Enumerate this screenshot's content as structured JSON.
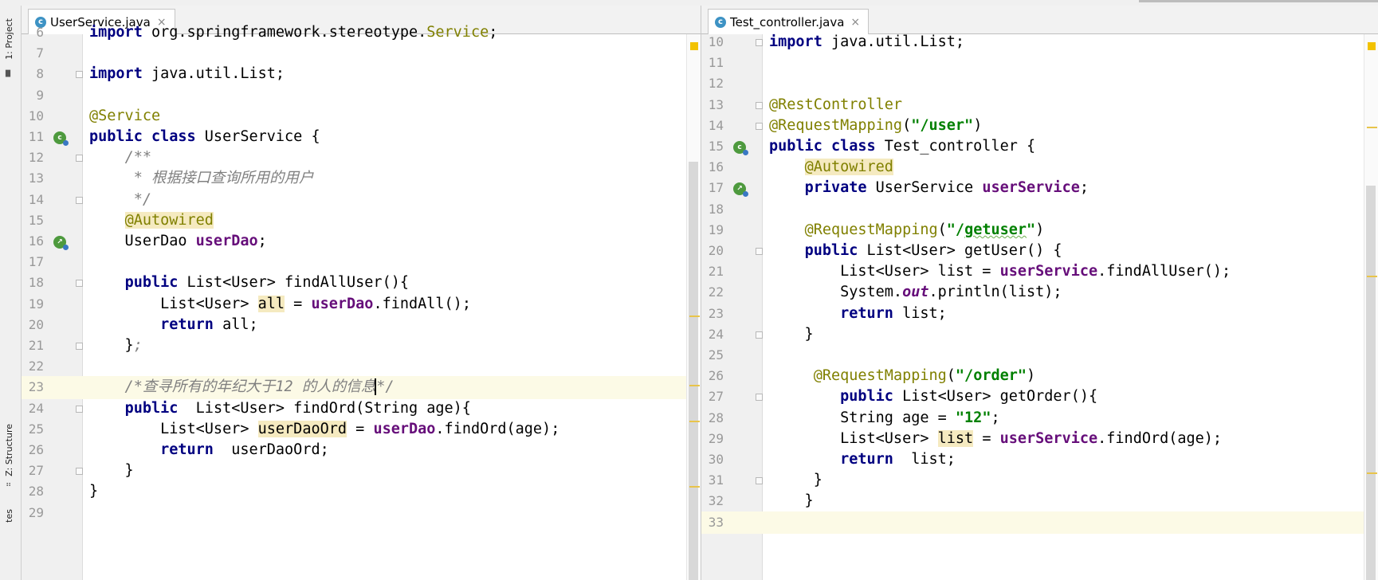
{
  "sidebar": {
    "project_tab": "1: Project",
    "structure_tab": "Z: Structure",
    "bottom_tab": "tes"
  },
  "left_editor": {
    "tab": {
      "label": "UserService.java",
      "icon_letter": "c"
    },
    "lines": [
      {
        "num": "6",
        "html": "<span class=\"kw\">import</span> org.springframework.stereotype.<span class=\"ann\">Service</span>;",
        "fold": false,
        "gutter_icon": "none",
        "current": false
      },
      {
        "num": "7",
        "html": "",
        "fold": false,
        "gutter_icon": "none",
        "current": false
      },
      {
        "num": "8",
        "html": "<span class=\"kw\">import</span> java.util.List;",
        "fold": true,
        "gutter_icon": "none",
        "current": false
      },
      {
        "num": "9",
        "html": "",
        "fold": false,
        "gutter_icon": "none",
        "current": false
      },
      {
        "num": "10",
        "html": "<span class=\"ann\">@Service</span>",
        "fold": false,
        "gutter_icon": "none",
        "current": false
      },
      {
        "num": "11",
        "html": "<span class=\"kw\">public class</span> UserService {",
        "fold": false,
        "gutter_icon": "bean",
        "current": false
      },
      {
        "num": "12",
        "html": "    <span class=\"cmt\">/**</span>",
        "fold": true,
        "gutter_icon": "none",
        "current": false
      },
      {
        "num": "13",
        "html": "<span class=\"cmt\">     * 根据接口查询所用的用户</span>",
        "fold": false,
        "gutter_icon": "none",
        "current": false
      },
      {
        "num": "14",
        "html": "<span class=\"cmt\">     */</span>",
        "fold": true,
        "gutter_icon": "none",
        "current": false
      },
      {
        "num": "15",
        "html": "    <span class=\"ann hl\">@Autowired</span>",
        "fold": false,
        "gutter_icon": "none",
        "current": false
      },
      {
        "num": "16",
        "html": "    UserDao <span class=\"fld\">userDao</span>;",
        "fold": false,
        "gutter_icon": "autowire",
        "current": false
      },
      {
        "num": "17",
        "html": "",
        "fold": false,
        "gutter_icon": "none",
        "current": false
      },
      {
        "num": "18",
        "html": "    <span class=\"kw\">public</span> List&lt;User&gt; findAllUser(){",
        "fold": true,
        "gutter_icon": "none",
        "current": false
      },
      {
        "num": "19",
        "html": "        List&lt;User&gt; <span class=\"hl\">all</span> = <span class=\"fld\">userDao</span>.findAll();",
        "fold": false,
        "gutter_icon": "none",
        "current": false
      },
      {
        "num": "20",
        "html": "        <span class=\"kw\">return</span> all;",
        "fold": false,
        "gutter_icon": "none",
        "current": false
      },
      {
        "num": "21",
        "html": "    }<span class=\"cmt\">;</span>",
        "fold": true,
        "gutter_icon": "none",
        "current": false
      },
      {
        "num": "22",
        "html": "",
        "fold": false,
        "gutter_icon": "none",
        "current": false
      },
      {
        "num": "23",
        "html": "<span class=\"cmt\">    /*查寻所有的年纪大于12 的人的信息<span class=\"caret\"></span>*/</span>",
        "fold": false,
        "gutter_icon": "none",
        "current": true
      },
      {
        "num": "24",
        "html": "    <span class=\"kw\">public</span>  List&lt;User&gt; findOrd(String age){",
        "fold": true,
        "gutter_icon": "none",
        "current": false
      },
      {
        "num": "25",
        "html": "        List&lt;User&gt; <span class=\"hl\">userDaoOrd</span> = <span class=\"fld\">userDao</span>.findOrd(age);",
        "fold": false,
        "gutter_icon": "none",
        "current": false
      },
      {
        "num": "26",
        "html": "        <span class=\"kw\">return</span>  userDaoOrd;",
        "fold": false,
        "gutter_icon": "none",
        "current": false
      },
      {
        "num": "27",
        "html": "    }",
        "fold": true,
        "gutter_icon": "none",
        "current": false
      },
      {
        "num": "28",
        "html": "}",
        "fold": false,
        "gutter_icon": "none",
        "current": false
      },
      {
        "num": "29",
        "html": "",
        "fold": false,
        "gutter_icon": "none",
        "current": false
      }
    ]
  },
  "right_editor": {
    "tab": {
      "label": "Test_controller.java",
      "icon_letter": "c"
    },
    "lines": [
      {
        "num": "10",
        "html": "<span class=\"kw\">import</span> java.util.List;",
        "fold": true,
        "gutter_icon": "none",
        "current": false
      },
      {
        "num": "11",
        "html": "",
        "fold": false,
        "gutter_icon": "none",
        "current": false
      },
      {
        "num": "12",
        "html": "",
        "fold": false,
        "gutter_icon": "none",
        "current": false
      },
      {
        "num": "13",
        "html": "<span class=\"ann\">@RestController</span>",
        "fold": true,
        "gutter_icon": "none",
        "current": false
      },
      {
        "num": "14",
        "html": "<span class=\"ann\">@RequestMapping</span>(<span class=\"str\">\"/user\"</span>)",
        "fold": true,
        "gutter_icon": "none",
        "current": false
      },
      {
        "num": "15",
        "html": "<span class=\"kw\">public class</span> Test_controller {",
        "fold": false,
        "gutter_icon": "bean",
        "current": false
      },
      {
        "num": "16",
        "html": "    <span class=\"ann hl\">@Autowired</span>",
        "fold": false,
        "gutter_icon": "none",
        "current": false
      },
      {
        "num": "17",
        "html": "    <span class=\"kw\">private</span> UserService <span class=\"fld\">userService</span>;",
        "fold": false,
        "gutter_icon": "autowire",
        "current": false
      },
      {
        "num": "18",
        "html": "",
        "fold": false,
        "gutter_icon": "none",
        "current": false
      },
      {
        "num": "19",
        "html": "    <span class=\"ann\">@RequestMapping</span>(<span class=\"str\">\"/<span class=\"ul\">getuser</span>\"</span>)",
        "fold": false,
        "gutter_icon": "none",
        "current": false
      },
      {
        "num": "20",
        "html": "    <span class=\"kw\">public</span> List&lt;User&gt; getUser() {",
        "fold": true,
        "gutter_icon": "none",
        "current": false
      },
      {
        "num": "21",
        "html": "        List&lt;User&gt; list = <span class=\"fld\">userService</span>.findAllUser();",
        "fold": false,
        "gutter_icon": "none",
        "current": false
      },
      {
        "num": "22",
        "html": "        System.<span class=\"stat\">out</span>.println(list);",
        "fold": false,
        "gutter_icon": "none",
        "current": false
      },
      {
        "num": "23",
        "html": "        <span class=\"kw\">return</span> list;",
        "fold": false,
        "gutter_icon": "none",
        "current": false
      },
      {
        "num": "24",
        "html": "    }",
        "fold": true,
        "gutter_icon": "none",
        "current": false
      },
      {
        "num": "25",
        "html": "",
        "fold": false,
        "gutter_icon": "none",
        "current": false
      },
      {
        "num": "26",
        "html": "     <span class=\"ann\">@RequestMapping</span>(<span class=\"str\">\"/order\"</span>)",
        "fold": false,
        "gutter_icon": "none",
        "current": false
      },
      {
        "num": "27",
        "html": "        <span class=\"kw\">public</span> List&lt;User&gt; getOrder(){",
        "fold": true,
        "gutter_icon": "none",
        "current": false
      },
      {
        "num": "28",
        "html": "        String age = <span class=\"str\">\"12\"</span>;",
        "fold": false,
        "gutter_icon": "none",
        "current": false
      },
      {
        "num": "29",
        "html": "        List&lt;User&gt; <span class=\"hl\">list</span> = <span class=\"fld\">userService</span>.findOrd(age);",
        "fold": false,
        "gutter_icon": "none",
        "current": false
      },
      {
        "num": "30",
        "html": "        <span class=\"kw\">return</span>  list;",
        "fold": false,
        "gutter_icon": "none",
        "current": false
      },
      {
        "num": "31",
        "html": "     }",
        "fold": true,
        "gutter_icon": "none",
        "current": false
      },
      {
        "num": "32",
        "html": "    }",
        "fold": false,
        "gutter_icon": "none",
        "current": false
      },
      {
        "num": "33",
        "html": "",
        "fold": false,
        "gutter_icon": "none",
        "current": true
      }
    ]
  },
  "colors": {
    "keyword": "#000080",
    "annotation": "#808000",
    "field": "#660e7a",
    "string": "#008000",
    "comment": "#808080",
    "current_line": "#fcfae6",
    "usage_highlight": "#f5eac0",
    "warning_marker": "#f2c200"
  },
  "icons": {
    "bean_gutter": "spring-bean-icon",
    "autowire_gutter": "autowired-navigate-icon",
    "fold": "fold-marker-icon"
  }
}
